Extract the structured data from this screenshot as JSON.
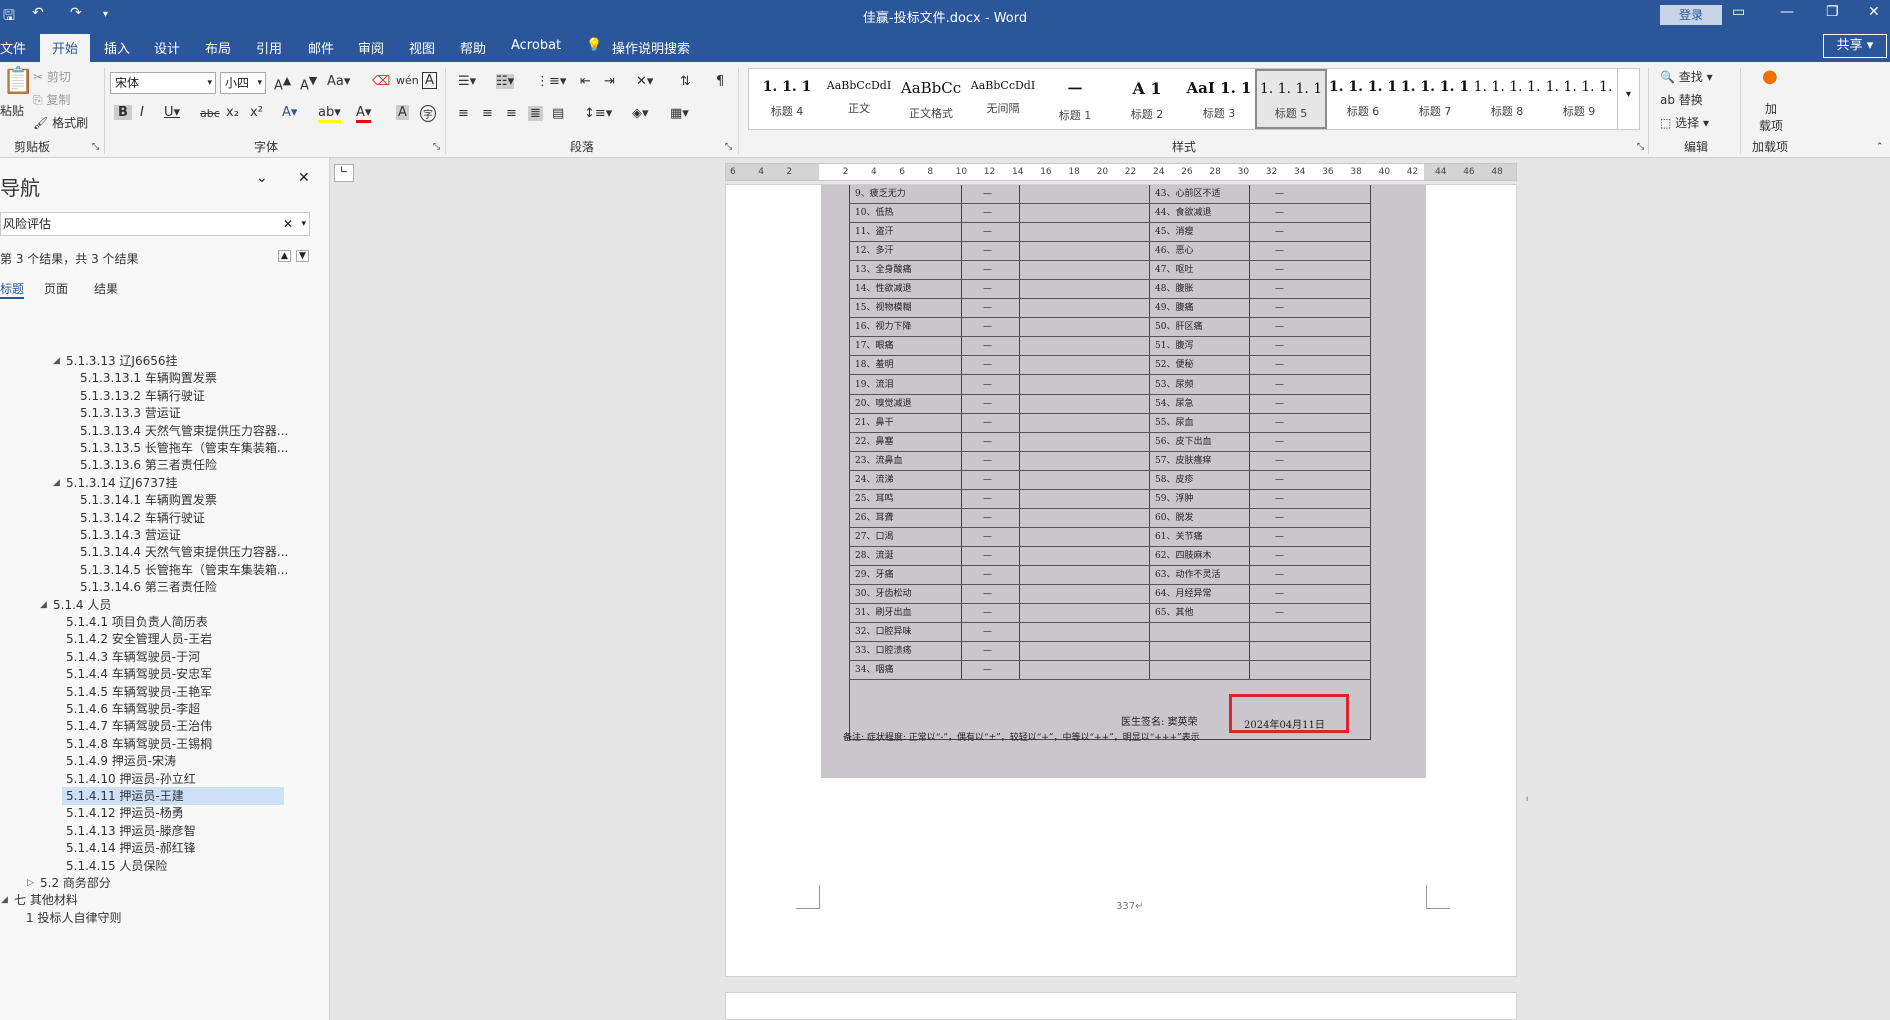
{
  "window": {
    "title": "佳赢-投标文件.docx  -  Word",
    "login": "登录",
    "share": "共享"
  },
  "tabs": [
    "文件",
    "开始",
    "插入",
    "设计",
    "布局",
    "引用",
    "邮件",
    "审阅",
    "视图",
    "帮助",
    "Acrobat",
    "操作说明搜索"
  ],
  "clipboard": {
    "paste": "粘贴",
    "cut": "剪切",
    "copy": "复制",
    "format_painter": "格式刷",
    "label": "剪贴板"
  },
  "font": {
    "name": "宋体",
    "size": "小四",
    "label": "字体"
  },
  "paragraph": {
    "label": "段落"
  },
  "styles": {
    "label": "样式",
    "items": [
      {
        "sample": "1. 1. 1",
        "name": "标题 4"
      },
      {
        "sample": "AaBbCcDdI",
        "name": "正文"
      },
      {
        "sample": "AaBbCc",
        "name": "正文格式"
      },
      {
        "sample": "AaBbCcDdI",
        "name": "无间隔"
      },
      {
        "sample": "一",
        "name": "标题 1"
      },
      {
        "sample": "A 1",
        "name": "标题 2"
      },
      {
        "sample": "AaI 1. 1",
        "name": "标题 3"
      },
      {
        "sample": "1. 1. 1. 1",
        "name": "标题 5"
      },
      {
        "sample": "1. 1. 1. 1",
        "name": "标题 6"
      },
      {
        "sample": "1. 1. 1. 1",
        "name": "标题 7"
      },
      {
        "sample": "1. 1. 1. 1.",
        "name": "标题 8"
      },
      {
        "sample": "1. 1. 1. 1.",
        "name": "标题 9"
      }
    ]
  },
  "editing": {
    "find": "查找",
    "replace": "替换",
    "select": "选择",
    "label": "编辑"
  },
  "addins": {
    "button": "加\n载项",
    "label": "加载项"
  },
  "nav": {
    "title": "导航",
    "search_value": "风险评估",
    "results": "第 3 个结果，共 3 个结果",
    "tabs": [
      "标题",
      "页面",
      "结果"
    ],
    "items": [
      "5.1.3.13 辽J6656挂",
      "5.1.3.13.1 车辆购置发票",
      "5.1.3.13.2 车辆行驶证",
      "5.1.3.13.3 营运证",
      "5.1.3.13.4 天然气管束提供压力容器...",
      "5.1.3.13.5 长管拖车（管束车集装箱...",
      "5.1.3.13.6 第三者责任险",
      "5.1.3.14 辽J6737挂",
      "5.1.3.14.1 车辆购置发票",
      "5.1.3.14.2 车辆行驶证",
      "5.1.3.14.3 营运证",
      "5.1.3.14.4 天然气管束提供压力容器...",
      "5.1.3.14.5 长管拖车（管束车集装箱...",
      "5.1.3.14.6 第三者责任险",
      "5.1.4 人员",
      "5.1.4.1 项目负责人简历表",
      "5.1.4.2 安全管理人员-王岩",
      "5.1.4.3 车辆驾驶员-于河",
      "5.1.4.4 车辆驾驶员-安忠军",
      "5.1.4.5 车辆驾驶员-王艳军",
      "5.1.4.6 车辆驾驶员-李超",
      "5.1.4.7 车辆驾驶员-王治伟",
      "5.1.4.8 车辆驾驶员-王锡桐",
      "5.1.4.9 押运员-宋涛",
      "5.1.4.10 押运员-孙立红",
      "5.1.4.11 押运员-王建",
      "5.1.4.12 押运员-杨勇",
      "5.1.4.13 押运员-滕彦智",
      "5.1.4.14 押运员-郝红锋",
      "5.1.4.15 人员保险",
      "5.2 商务部分",
      "七 其他材料",
      "1 投标人自律守则"
    ]
  },
  "ruler": [
    "6",
    "4",
    "2",
    "",
    "2",
    "4",
    "6",
    "8",
    "10",
    "12",
    "14",
    "16",
    "18",
    "20",
    "22",
    "24",
    "26",
    "28",
    "30",
    "32",
    "34",
    "36",
    "38",
    "40",
    "42",
    "44",
    "46",
    "48"
  ],
  "doc": {
    "left_rows": [
      "9、疲乏无力",
      "10、低热",
      "11、盗汗",
      "12、多汗",
      "13、全身酸痛",
      "14、性欲减退",
      "15、视物模糊",
      "16、视力下降",
      "17、眼痛",
      "18、羞明",
      "19、流泪",
      "20、嗅觉减退",
      "21、鼻干",
      "22、鼻塞",
      "23、流鼻血",
      "24、流涕",
      "25、耳鸣",
      "26、耳聋",
      "27、口渴",
      "28、流涎",
      "29、牙痛",
      "30、牙齿松动",
      "31、刷牙出血",
      "32、口腔异味",
      "33、口腔溃疡",
      "34、咽痛"
    ],
    "right_rows": [
      "43、心前区不适",
      "44、食欲减退",
      "45、消瘦",
      "46、恶心",
      "47、呕吐",
      "48、腹胀",
      "49、腹痛",
      "50、肝区痛",
      "51、腹泻",
      "52、便秘",
      "53、尿频",
      "54、尿急",
      "55、尿血",
      "56、皮下出血",
      "57、皮肤瘙痒",
      "58、皮疹",
      "59、浮肿",
      "60、脱发",
      "61、关节痛",
      "62、四肢麻木",
      "63、动作不灵活",
      "64、月经异常",
      "65、其他"
    ],
    "mark": "—",
    "doctor_sign": "医生签名: 窦英荣",
    "date": "2024年04月11日",
    "note": "备注: 症状程度: 正常以“-”，偶有以“±”，较轻以“+”，中等以“++”，明显以“+++”表示",
    "page_number": "337↵"
  }
}
